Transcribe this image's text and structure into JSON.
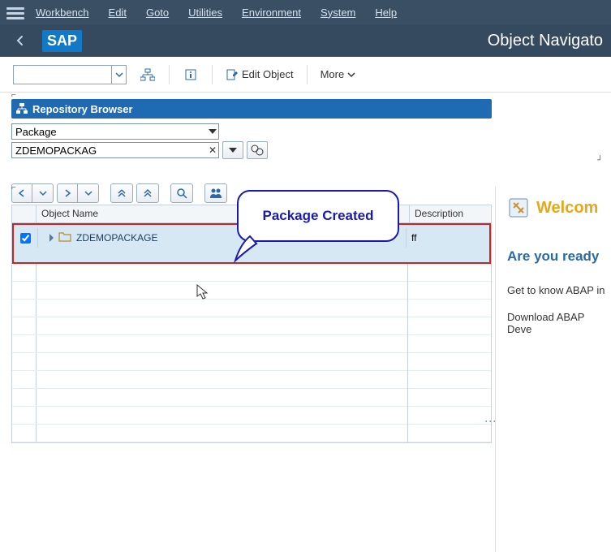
{
  "menubar": {
    "items": [
      "Workbench",
      "Edit",
      "Goto",
      "Utilities",
      "Environment",
      "System",
      "Help"
    ]
  },
  "titlebar": {
    "logo_text": "SAP",
    "title": "Object Navigato"
  },
  "toolbar": {
    "edit_object_label": "Edit Object",
    "more_label": "More"
  },
  "repo": {
    "header_label": "Repository Browser",
    "selector_value": "Package",
    "input_value": "ZDEMOPACKAG"
  },
  "tree": {
    "columns": {
      "name": "Object Name",
      "desc": "Description"
    },
    "row": {
      "label": "ZDEMOPACKAGE",
      "desc": "ff",
      "checked": true
    }
  },
  "right": {
    "welcome": "Welcom",
    "ready": "Are you ready",
    "link1": "Get to know ABAP in ",
    "link2": "Download ABAP Deve"
  },
  "callout": {
    "text": "Package Created"
  }
}
